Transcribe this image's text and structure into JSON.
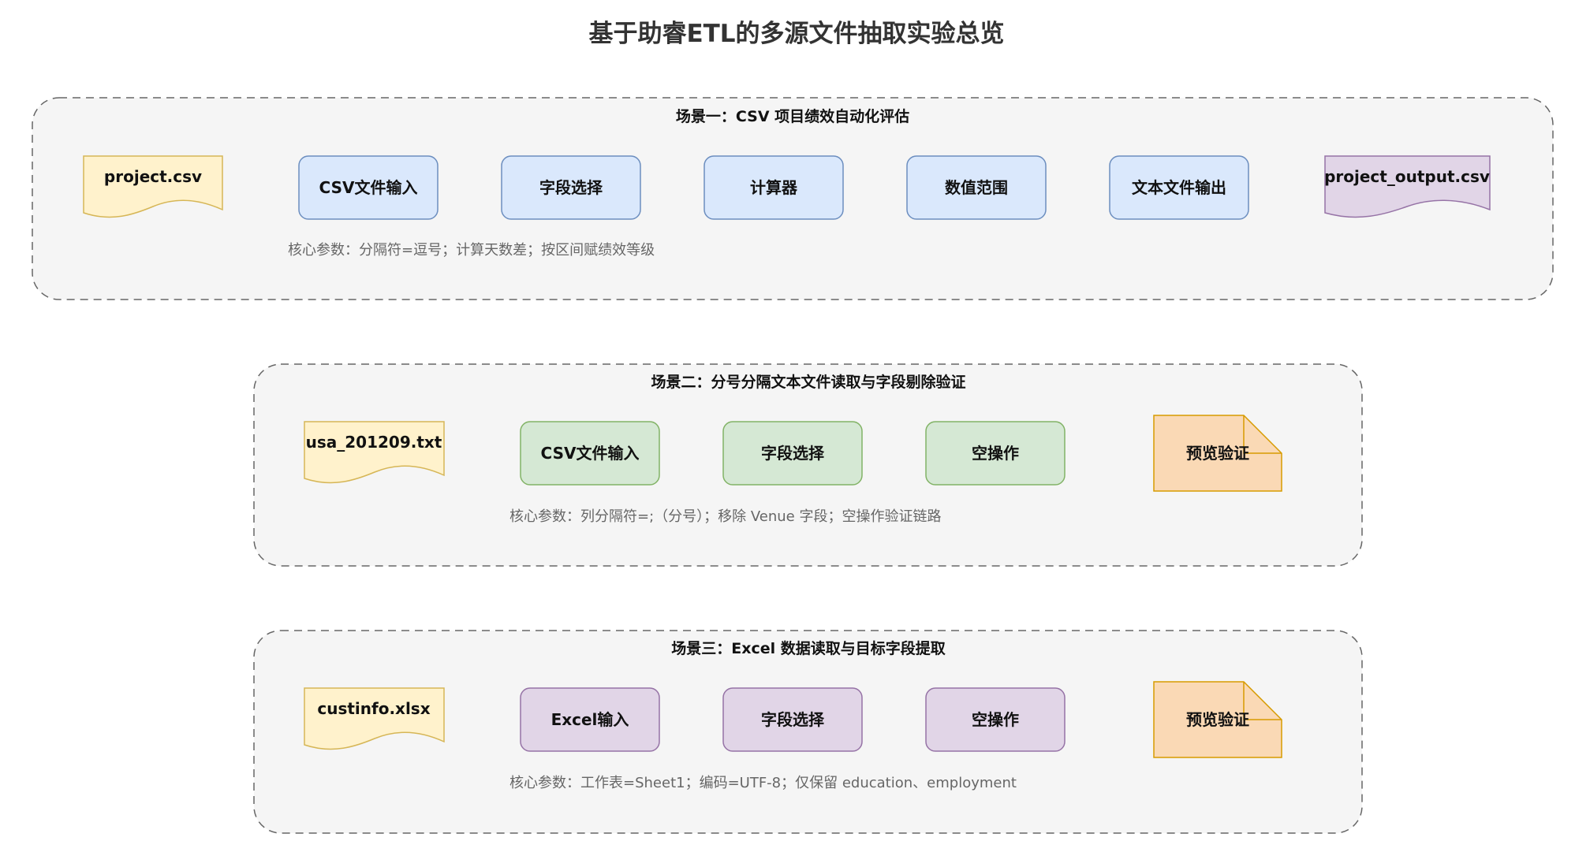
{
  "title": "基于助睿ETL的多源文件抽取实验总览",
  "colors": {
    "panel_fill": "#f5f5f5",
    "panel_border": "#666666",
    "file_fill": "#fff2cc",
    "file_border": "#d6b656",
    "blue_fill": "#dae8fc",
    "blue_border": "#6c8ebf",
    "green_fill": "#d5e8d4",
    "green_border": "#82b366",
    "purple_fill": "#e1d5e7",
    "purple_border": "#9673a6",
    "orange_fill": "#fad9b5",
    "orange_border": "#d79b00"
  },
  "scenes": [
    {
      "title": "场景一：CSV 项目绩效自动化评估",
      "input_file": "project.csv",
      "steps": [
        "CSV文件输入",
        "字段选择",
        "计算器",
        "数值范围",
        "文本文件输出"
      ],
      "output": "project_output.csv",
      "params": "核心参数：分隔符=逗号；计算天数差；按区间赋绩效等级"
    },
    {
      "title": "场景二：分号分隔文本文件读取与字段剔除验证",
      "input_file": "usa_201209.txt",
      "steps": [
        "CSV文件输入",
        "字段选择",
        "空操作"
      ],
      "output": "预览验证",
      "params": "核心参数：列分隔符=;（分号）；移除 Venue 字段；空操作验证链路"
    },
    {
      "title": "场景三：Excel 数据读取与目标字段提取",
      "input_file": "custinfo.xlsx",
      "steps": [
        "Excel输入",
        "字段选择",
        "空操作"
      ],
      "output": "预览验证",
      "params": "核心参数：工作表=Sheet1；编码=UTF-8；仅保留 education、employment"
    }
  ]
}
